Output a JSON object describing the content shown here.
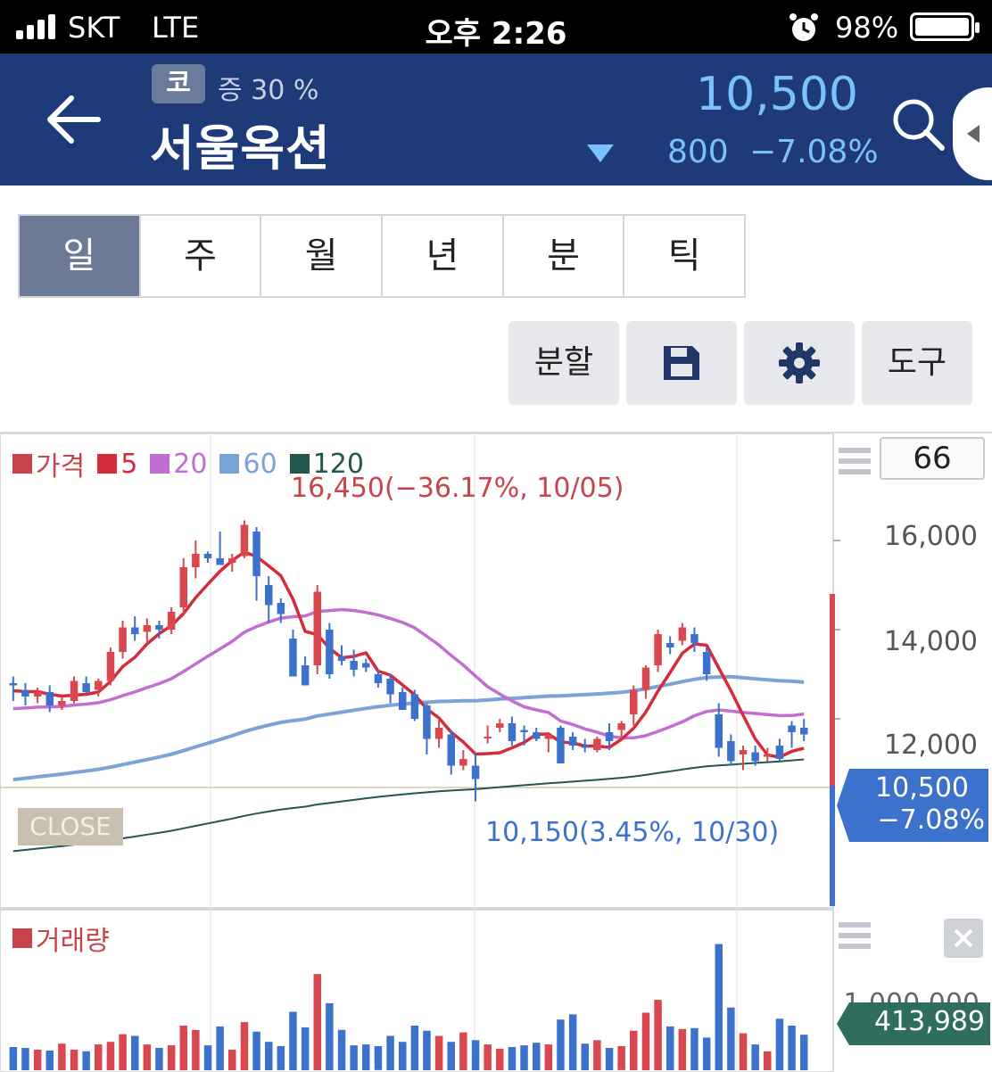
{
  "status_bar": {
    "carrier": "SKT",
    "network": "LTE",
    "time": "오후 2:26",
    "battery": "98%"
  },
  "header": {
    "market_badge": "코",
    "margin": "증 30 %",
    "stock_name": "서울옥션",
    "price": "10,500",
    "change": "800",
    "change_pct": "−7.08%",
    "colors": {
      "bg": "#1e3a78",
      "price": "#7cc0ff"
    }
  },
  "periods": [
    {
      "label": "일",
      "active": true
    },
    {
      "label": "주"
    },
    {
      "label": "월"
    },
    {
      "label": "년"
    },
    {
      "label": "분"
    },
    {
      "label": "틱"
    }
  ],
  "tools": {
    "split": "분할",
    "save_icon": "save-icon",
    "settings_icon": "gear-icon",
    "tools": "도구"
  },
  "chart": {
    "legend": [
      {
        "label": "가격",
        "color": "#c8434a"
      },
      {
        "label": "5",
        "color": "#d62a3a"
      },
      {
        "label": "20",
        "color": "#c26ed1"
      },
      {
        "label": "60",
        "color": "#7aa3d6"
      },
      {
        "label": "120",
        "color": "#23564c"
      }
    ],
    "candle_count": "66",
    "max_label": "16,450(−36.17%, 10/05)",
    "min_label": "10,150(3.45%, 10/30)",
    "close_tag": "CLOSE",
    "y_ticks": [
      "16,000",
      "14,000",
      "12,000"
    ],
    "current_price": "10,500",
    "current_pct": "−7.08%",
    "volume_legend": "거래량",
    "volume_tick": "1,000,000",
    "current_volume": "413,989"
  },
  "chart_data": {
    "type": "candlestick",
    "ylim": [
      9600,
      17200
    ],
    "candles": [
      [
        12800,
        12950,
        12400,
        12750
      ],
      [
        12650,
        12800,
        12300,
        12500
      ],
      [
        12500,
        12700,
        12350,
        12600
      ],
      [
        12600,
        12750,
        12150,
        12300
      ],
      [
        12300,
        12500,
        12200,
        12400
      ],
      [
        12400,
        12950,
        12350,
        12850
      ],
      [
        12800,
        12950,
        12550,
        12600
      ],
      [
        12650,
        12900,
        12500,
        12850
      ],
      [
        12850,
        13600,
        12750,
        13500
      ],
      [
        13500,
        14200,
        13350,
        14050
      ],
      [
        14050,
        14300,
        13750,
        13900
      ],
      [
        13950,
        14250,
        13700,
        14100
      ],
      [
        14100,
        14200,
        13800,
        14000
      ],
      [
        14000,
        14500,
        13900,
        14400
      ],
      [
        14500,
        15600,
        14350,
        15400
      ],
      [
        15400,
        16000,
        15150,
        15700
      ],
      [
        15700,
        15750,
        15500,
        15600
      ],
      [
        15600,
        16200,
        15550,
        15450
      ],
      [
        15500,
        15700,
        15300,
        15600
      ],
      [
        15650,
        16450,
        15600,
        16350
      ],
      [
        16200,
        16300,
        14650,
        15200
      ],
      [
        15000,
        15200,
        14150,
        14550
      ],
      [
        14600,
        14700,
        14150,
        14350
      ],
      [
        13800,
        14000,
        13600,
        12950
      ],
      [
        13200,
        13400,
        12750,
        12750
      ],
      [
        13200,
        15000,
        13000,
        14850
      ],
      [
        14000,
        14150,
        12900,
        13000
      ],
      [
        13400,
        13650,
        13200,
        13300
      ],
      [
        13300,
        13550,
        12950,
        13100
      ],
      [
        13250,
        13350,
        13050,
        13150
      ],
      [
        13000,
        13100,
        12700,
        12800
      ],
      [
        12900,
        13000,
        12350,
        12550
      ],
      [
        12600,
        12700,
        12200,
        12200
      ],
      [
        12550,
        12650,
        11950,
        12000
      ],
      [
        12300,
        12350,
        11200,
        11550
      ],
      [
        11550,
        12000,
        11350,
        11800
      ],
      [
        11650,
        11750,
        10750,
        10950
      ],
      [
        10950,
        11300,
        10850,
        11100
      ],
      [
        10950,
        11250,
        10150,
        10650
      ],
      [
        11600,
        11850,
        11450,
        11600
      ],
      [
        11800,
        12000,
        11700,
        11900
      ],
      [
        11900,
        12050,
        11400,
        11500
      ],
      [
        11750,
        11850,
        11400,
        11700
      ],
      [
        11700,
        11800,
        11500,
        11550
      ],
      [
        11550,
        11700,
        11250,
        11650
      ],
      [
        11800,
        11850,
        11150,
        11000
      ],
      [
        11600,
        11700,
        11300,
        11400
      ],
      [
        11400,
        11550,
        11250,
        11350
      ],
      [
        11300,
        11600,
        11250,
        11550
      ],
      [
        11700,
        11900,
        11300,
        11500
      ],
      [
        11750,
        11950,
        11550,
        11900
      ],
      [
        12100,
        12750,
        11850,
        12650
      ],
      [
        12650,
        13200,
        12450,
        13150
      ],
      [
        13200,
        14000,
        13050,
        13900
      ],
      [
        13700,
        13850,
        13450,
        13600
      ],
      [
        13750,
        14150,
        13650,
        14050
      ],
      [
        13900,
        14050,
        13500,
        13700
      ],
      [
        13500,
        13600,
        12850,
        13000
      ],
      [
        12100,
        12350,
        11150,
        11350
      ],
      [
        11500,
        11650,
        10950,
        11050
      ],
      [
        11200,
        11400,
        10850,
        11300
      ],
      [
        11250,
        11400,
        10950,
        11050
      ],
      [
        11150,
        11350,
        11050,
        11200
      ],
      [
        11400,
        11550,
        11050,
        11100
      ],
      [
        11850,
        11950,
        11350,
        11700
      ],
      [
        11800,
        12000,
        11500,
        11650
      ]
    ],
    "volumes": [
      270000,
      260000,
      240000,
      230000,
      310000,
      240000,
      220000,
      300000,
      330000,
      420000,
      400000,
      300000,
      260000,
      290000,
      520000,
      470000,
      290000,
      510000,
      240000,
      560000,
      450000,
      330000,
      280000,
      680000,
      500000,
      1120000,
      780000,
      470000,
      290000,
      300000,
      280000,
      400000,
      330000,
      520000,
      460000,
      400000,
      330000,
      440000,
      350000,
      300000,
      250000,
      270000,
      290000,
      320000,
      300000,
      590000,
      650000,
      310000,
      350000,
      260000,
      280000,
      460000,
      670000,
      820000,
      510000,
      480000,
      490000,
      380000,
      1470000,
      730000,
      430000,
      300000,
      220000,
      600000,
      520000,
      413989
    ],
    "ma_period_labels": [
      "5",
      "20",
      "60",
      "120"
    ]
  }
}
